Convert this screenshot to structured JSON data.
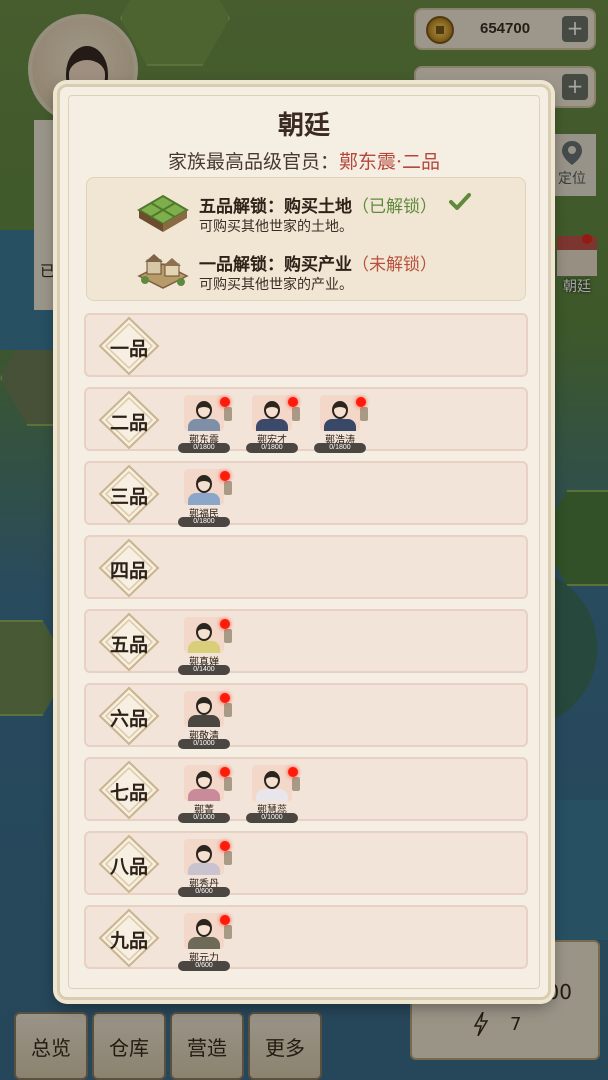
{
  "hud": {
    "coins": "654700",
    "plus": "+",
    "side_label": "已",
    "locate_label": "定位",
    "court_label": "朝廷"
  },
  "nav": [
    "总览",
    "仓库",
    "营造",
    "更多"
  ],
  "scroll": {
    "value_partial": "00",
    "energy": "7"
  },
  "modal": {
    "title": "朝廷",
    "subtitle_prefix": "家族最高品级官员：",
    "subtitle_highlight": "鄚东震·二品",
    "unlocks": [
      {
        "head": "五品解锁：购买土地",
        "status": "（已解锁）",
        "desc": "可购买其他世家的土地。",
        "unlocked": true
      },
      {
        "head": "一品解锁：购买产业",
        "status": "（未解锁）",
        "desc": "可购买其他世家的产业。",
        "unlocked": false
      }
    ],
    "ranks": [
      {
        "label": "一品",
        "officials": []
      },
      {
        "label": "二品",
        "officials": [
          {
            "name": "鄚东震",
            "progress": "0/1800",
            "robe": "#7f8fa8"
          },
          {
            "name": "鄚宏才",
            "progress": "0/1800",
            "robe": "#3b4a6a"
          },
          {
            "name": "鄚浩涛",
            "progress": "0/1800",
            "robe": "#3a4868"
          }
        ]
      },
      {
        "label": "三品",
        "officials": [
          {
            "name": "鄚福民",
            "progress": "0/1800",
            "robe": "#8aa6c8"
          }
        ]
      },
      {
        "label": "四品",
        "officials": []
      },
      {
        "label": "五品",
        "officials": [
          {
            "name": "鄚真婵",
            "progress": "0/1400",
            "robe": "#d9cf7a"
          }
        ]
      },
      {
        "label": "六品",
        "officials": [
          {
            "name": "鄚敬清",
            "progress": "0/1000",
            "robe": "#4a4642"
          }
        ]
      },
      {
        "label": "七品",
        "officials": [
          {
            "name": "鄚菁",
            "progress": "0/1000",
            "robe": "#c98a9a"
          },
          {
            "name": "鄚慧蕊",
            "progress": "0/1000",
            "robe": "#e8e6ea"
          }
        ]
      },
      {
        "label": "八品",
        "officials": [
          {
            "name": "鄚秀丹",
            "progress": "0/600",
            "robe": "#c9c3cf"
          }
        ]
      },
      {
        "label": "九品",
        "officials": [
          {
            "name": "鄚元力",
            "progress": "0/600",
            "robe": "#6e6a58"
          }
        ]
      }
    ]
  },
  "colors": {
    "accent_red": "#b5473c",
    "unlocked_green": "#5f8a3c",
    "notify_dot": "#ff1a0a"
  }
}
